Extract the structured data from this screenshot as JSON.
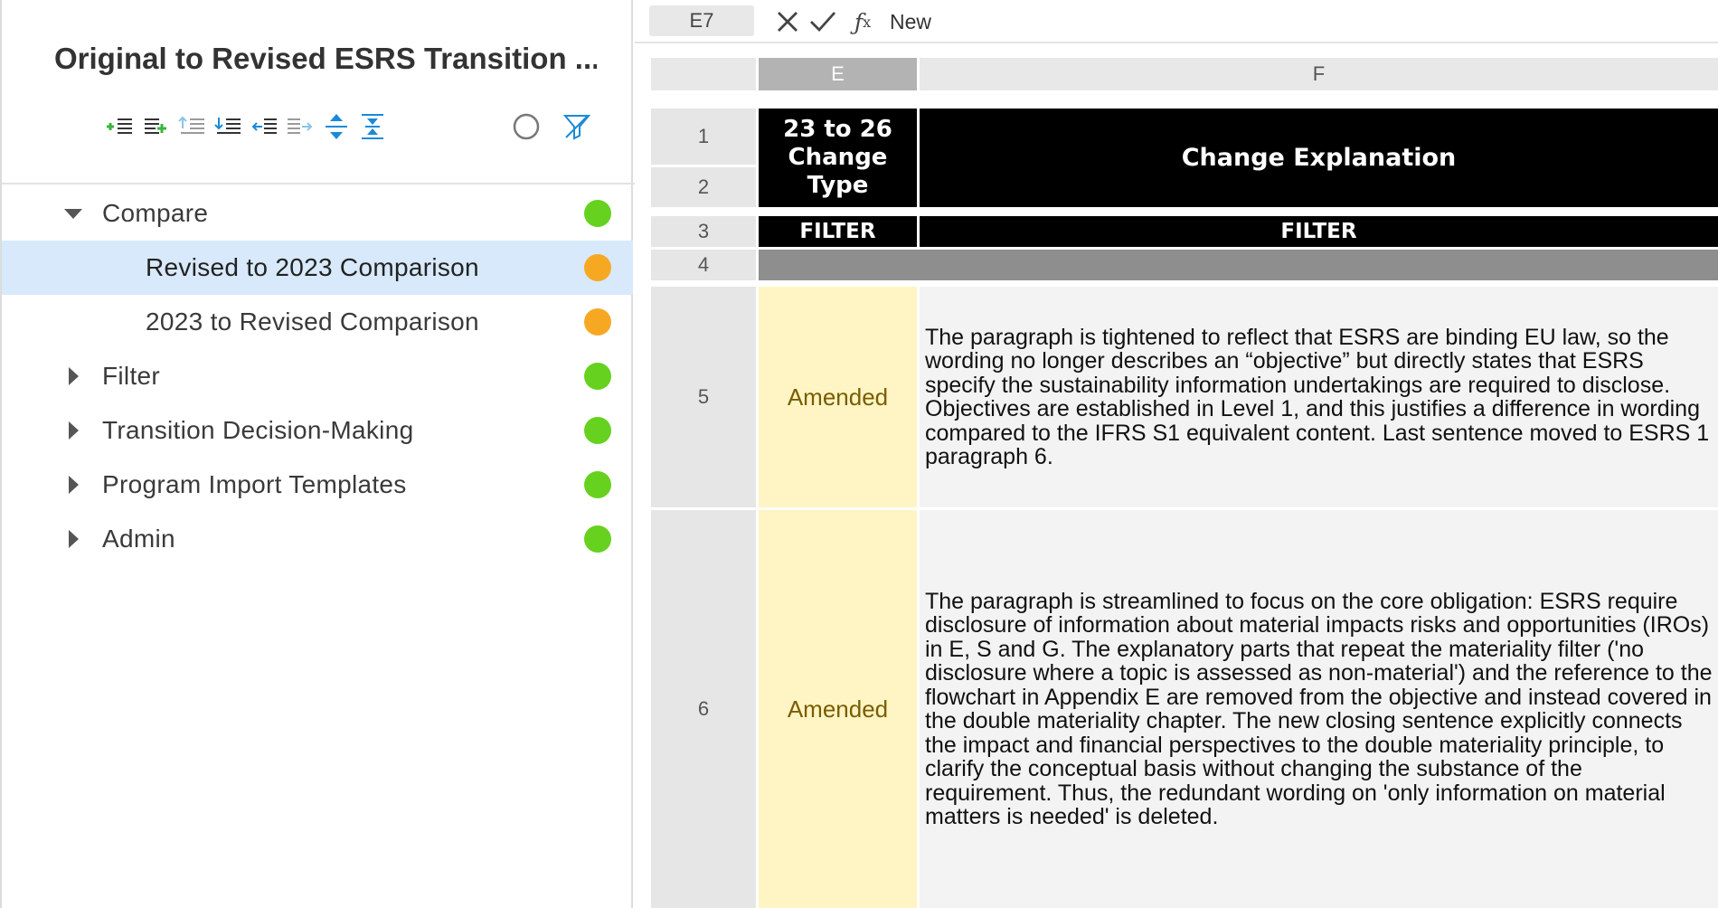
{
  "sidebar": {
    "title": "Original to Revised ESRS Transition ...",
    "toolbar_icons": [
      "add-row-above-icon",
      "add-row-below-icon",
      "outdent-icon",
      "indent-down-icon",
      "indent-icon",
      "move-right-icon",
      "expand-all-icon",
      "collapse-all-icon",
      "circle-status-icon",
      "filter-off-icon"
    ],
    "tree": [
      {
        "label": "Compare",
        "level": 0,
        "expanded": true,
        "status_color": "#66d11f",
        "selected": false
      },
      {
        "label": "Revised to 2023 Comparison",
        "level": 1,
        "status_color": "#f7a823",
        "selected": true
      },
      {
        "label": "2023 to Revised Comparison",
        "level": 1,
        "status_color": "#f7a823",
        "selected": false
      },
      {
        "label": "Filter",
        "level": 0,
        "expanded": false,
        "status_color": "#66d11f",
        "selected": false
      },
      {
        "label": "Transition Decision-Making",
        "level": 0,
        "expanded": false,
        "status_color": "#66d11f",
        "selected": false
      },
      {
        "label": "Program Import Templates",
        "level": 0,
        "expanded": false,
        "status_color": "#66d11f",
        "selected": false
      },
      {
        "label": "Admin",
        "level": 0,
        "expanded": false,
        "status_color": "#66d11f",
        "selected": false
      }
    ]
  },
  "formula_bar": {
    "cell_ref": "E7",
    "value": "New"
  },
  "grid": {
    "columns": [
      "E",
      "F"
    ],
    "active_column": "E",
    "row_numbers": [
      "1",
      "2",
      "3",
      "4",
      "5",
      "6"
    ],
    "header": {
      "change_type": "23 to 26 Change Type",
      "change_explanation": "Change Explanation"
    },
    "filter_row": [
      "FILTER",
      "FILTER"
    ],
    "rows": [
      {
        "row": "5",
        "type": "Amended",
        "explanation": "The paragraph is tightened to reflect that ESRS are binding EU law, so the wording no longer describes an “objective” but directly states that ESRS specify the sustainability information undertakings are required to disclose. Objectives are established in Level 1, and this justifies a difference in wording compared to the IFRS S1 equivalent content. Last sentence moved to ESRS 1 paragraph 6."
      },
      {
        "row": "6",
        "type": "Amended",
        "explanation": "The paragraph is streamlined to focus on the core obligation: ESRS require disclosure of information about material impacts risks and opportunities (IROs) in E, S and G. The explanatory parts that repeat the materiality filter ('no disclosure where a topic is assessed as non-material') and the reference to the flowchart in Appendix E are removed from the objective and instead covered in the double materiality chapter. The new closing sentence explicitly connects the impact and financial perspectives to the double materiality principle, to clarify the conceptual basis without changing the substance of the requirement. Thus, the redundant wording on 'only information on material matters is needed' is deleted."
      }
    ]
  },
  "colors": {
    "selected_row_bg": "#d7e9fa",
    "status_green": "#66d11f",
    "status_orange": "#f7a823",
    "type_cell_bg": "#fff5c4",
    "header_bg": "#000000"
  }
}
